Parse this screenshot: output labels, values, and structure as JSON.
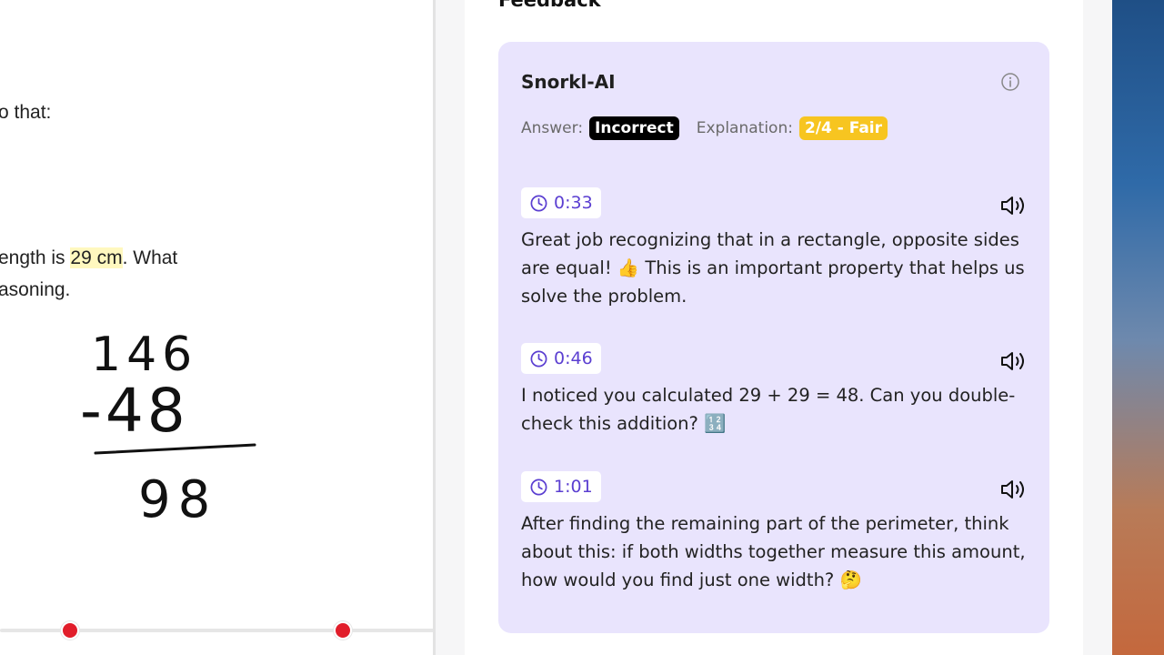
{
  "worksheet": {
    "lines": [
      {
        "parts": [
          {
            "text": "o that:",
            "hl": false
          }
        ]
      },
      {
        "parts": [
          {
            "text": "ength is ",
            "hl": false
          },
          {
            "text": "29 cm",
            "hl": true
          },
          {
            "text": ". What",
            "hl": false
          }
        ]
      },
      {
        "parts": [
          {
            "text": "asoning.",
            "hl": false
          }
        ]
      }
    ],
    "handwriting": {
      "top": "146",
      "subtract": "-48",
      "result": "98"
    },
    "timeline_marker_count": 2
  },
  "feedback": {
    "heading": "Feedback",
    "card_title": "Snorkl-AI",
    "answer_label": "Answer:",
    "answer_value": "Incorrect",
    "explanation_label": "Explanation:",
    "explanation_value": "2/4 - Fair",
    "info_icon": "info-circle-icon",
    "colors": {
      "card_bg": "#e9e4fd",
      "timestamp": "#5b3fd1",
      "incorrect_badge": "#000000",
      "fair_badge": "#f7c520",
      "timeline_marker": "#e11d2a"
    },
    "items": [
      {
        "time": "0:33",
        "text": "Great job recognizing that in a rectangle, opposite sides are equal! 👍 This is an important property that helps us solve the problem.",
        "icons": [
          "clock-icon",
          "speaker-icon"
        ]
      },
      {
        "time": "0:46",
        "text": "I noticed you calculated 29 + 29 = 48. Can you double-check this addition? 🔢",
        "icons": [
          "clock-icon",
          "speaker-icon"
        ]
      },
      {
        "time": "1:01",
        "text": "After finding the remaining part of the perimeter, think about this: if both widths together measure this amount, how would you find just one width? 🤔",
        "icons": [
          "clock-icon",
          "speaker-icon"
        ]
      }
    ]
  }
}
